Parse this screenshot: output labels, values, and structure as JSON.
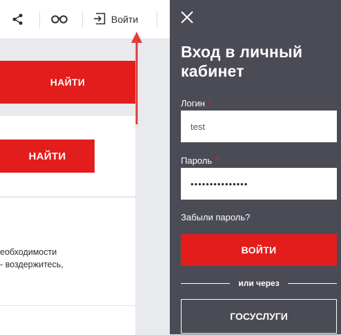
{
  "header": {
    "share_icon": "share-icon",
    "glasses_icon": "glasses-icon",
    "login_icon": "login-icon",
    "login_label": "Войти"
  },
  "content": {
    "search_button_1": "НАЙТИ",
    "search_button_2": "НАЙТИ",
    "text_line_1": "еобходимости",
    "text_line_2": "- воздержитесь,"
  },
  "login_panel": {
    "title": "Вход в личный кабинет",
    "login_label": "Логин",
    "login_required_mark": "*",
    "login_value": "test",
    "password_label": "Пароль",
    "password_required_mark": "*",
    "password_value": "•••••••••••••••",
    "forgot_password": "Забыли пароль?",
    "submit_label": "ВОЙТИ",
    "or_label": "или через",
    "gosuslugi_label": "ГОСУСЛУГИ"
  },
  "colors": {
    "accent_red": "#e31c1c",
    "panel_bg": "#4a4b54",
    "page_bg": "#e9eaee"
  }
}
